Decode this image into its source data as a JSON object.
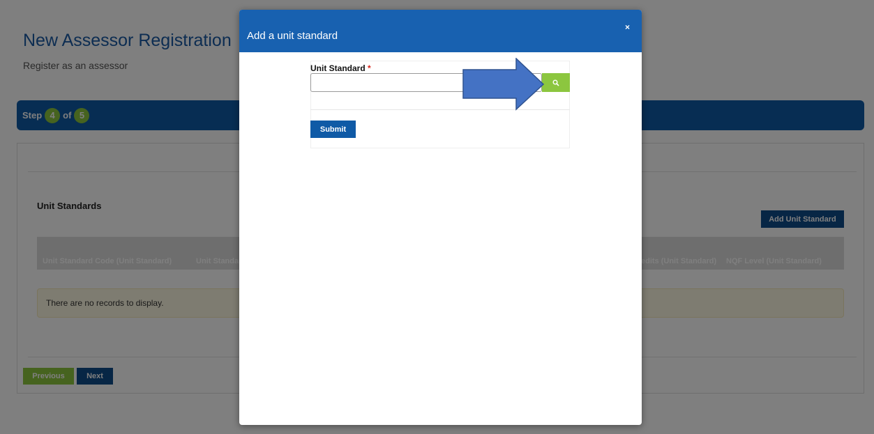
{
  "page": {
    "title": "New Assessor Registration",
    "subtitle": "Register as an assessor",
    "step": {
      "label": "Step",
      "current": "4",
      "of_label": "of",
      "total": "5"
    },
    "section_title": "Unit Standards",
    "add_button": "Add Unit Standard",
    "table_headers": [
      "Unit Standard Code (Unit Standard)",
      "Unit Standar",
      "edits (Unit Standard)",
      "NQF Level (Unit Standard)"
    ],
    "no_records": "There are no records to display.",
    "previous_button": "Previous",
    "next_button": "Next"
  },
  "modal": {
    "title": "Add a unit standard",
    "close_label": "×",
    "field_label": "Unit Standard",
    "required_mark": "*",
    "input_value": "",
    "submit_button": "Submit"
  },
  "colors": {
    "primary_blue": "#1861b0",
    "dark_blue": "#0f4c8a",
    "accent_green": "#8cc63f",
    "arrow_fill": "#4472c4",
    "warning_bg": "#fcf8e3"
  },
  "icons": {
    "search": "magnifier-icon",
    "annotation": "right-arrow-icon"
  }
}
